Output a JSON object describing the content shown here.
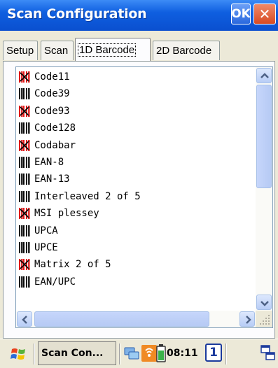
{
  "window": {
    "title": "Scan Configuration",
    "ok_label": "OK",
    "close_glyph": "✕"
  },
  "tabs": [
    {
      "label": "Setup",
      "active": false
    },
    {
      "label": "Scan",
      "active": false
    },
    {
      "label": "1D Barcode",
      "active": true
    },
    {
      "label": "2D Barcode",
      "active": false
    }
  ],
  "barcode_list": [
    {
      "label": "Code11",
      "enabled": false
    },
    {
      "label": "Code39",
      "enabled": true
    },
    {
      "label": "Code93",
      "enabled": false
    },
    {
      "label": "Code128",
      "enabled": true
    },
    {
      "label": "Codabar",
      "enabled": false
    },
    {
      "label": "EAN-8",
      "enabled": true
    },
    {
      "label": "EAN-13",
      "enabled": true
    },
    {
      "label": "Interleaved 2 of 5",
      "enabled": true
    },
    {
      "label": "MSI plessey",
      "enabled": false
    },
    {
      "label": "UPCA",
      "enabled": true
    },
    {
      "label": "UPCE",
      "enabled": true
    },
    {
      "label": "Matrix 2 of 5",
      "enabled": false
    },
    {
      "label": "EAN/UPC",
      "enabled": true
    }
  ],
  "icons": {
    "enabled": "barcode-enabled-icon",
    "disabled": "barcode-disabled-icon"
  },
  "colors": {
    "titlebar": "#0f5fe0",
    "disabled_red": "#e01010",
    "scroll_blue": "#b6caf4"
  },
  "taskbar": {
    "app_label": "Scan Con...",
    "clock": "08:11",
    "input_indicator": "1"
  }
}
